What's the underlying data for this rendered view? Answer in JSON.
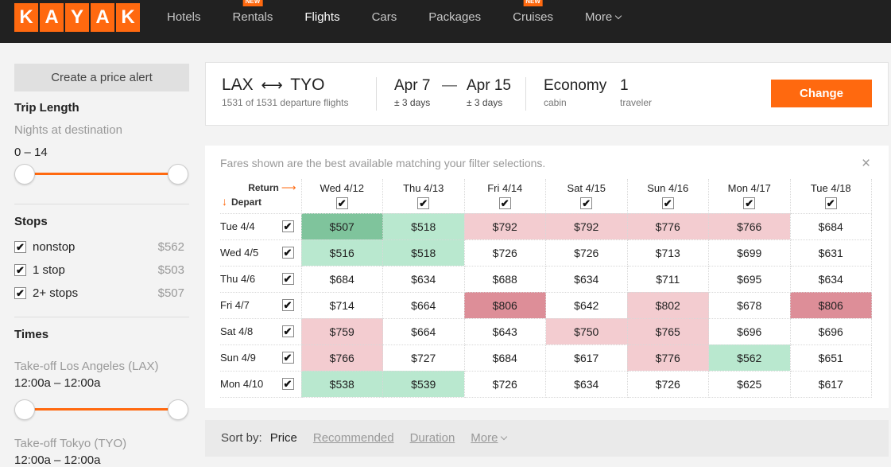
{
  "header": {
    "logo_letters": [
      "K",
      "A",
      "Y",
      "A",
      "K"
    ],
    "nav": [
      {
        "label": "Hotels",
        "badge": "",
        "active": false
      },
      {
        "label": "Rentals",
        "badge": "NEW",
        "active": false
      },
      {
        "label": "Flights",
        "badge": "",
        "active": true
      },
      {
        "label": "Cars",
        "badge": "",
        "active": false
      },
      {
        "label": "Packages",
        "badge": "",
        "active": false
      },
      {
        "label": "Cruises",
        "badge": "NEW",
        "active": false
      },
      {
        "label": "More",
        "badge": "",
        "active": false,
        "dropdown": true
      }
    ]
  },
  "sidebar": {
    "alert_button": "Create a price alert",
    "trip_length": {
      "title": "Trip Length",
      "label": "Nights at destination",
      "range": "0 – 14",
      "min_frac": 0,
      "max_frac": 1
    },
    "stops": {
      "title": "Stops",
      "items": [
        {
          "label": "nonstop",
          "price": "$562",
          "checked": true
        },
        {
          "label": "1 stop",
          "price": "$503",
          "checked": true
        },
        {
          "label": "2+ stops",
          "price": "$507",
          "checked": true
        }
      ]
    },
    "times": {
      "title": "Times",
      "takeoff_lax": {
        "label": "Take-off Los Angeles (LAX)",
        "range": "12:00a – 12:00a",
        "min_frac": 0,
        "max_frac": 1
      },
      "takeoff_tyo": {
        "label": "Take-off Tokyo (TYO)",
        "range": "12:00a – 12:00a"
      }
    }
  },
  "summary": {
    "route_from": "LAX",
    "route_arrow": "⟷",
    "route_to": "TYO",
    "flights_count": "1531 of 1531 departure flights",
    "depart_date": "Apr 7",
    "date_dash": "—",
    "return_date": "Apr 15",
    "depart_flex": "± 3 days",
    "return_flex": "± 3 days",
    "cabin_value": "Economy",
    "cabin_label": "cabin",
    "travelers_value": "1",
    "travelers_label": "traveler",
    "change_button": "Change"
  },
  "matrix": {
    "notice": "Fares shown are the best available matching your filter selections.",
    "close": "×",
    "return_label": "Return",
    "depart_label": "Depart",
    "columns": [
      "Wed 4/12",
      "Thu 4/13",
      "Fri 4/14",
      "Sat 4/15",
      "Sun 4/16",
      "Mon 4/17",
      "Tue 4/18"
    ],
    "rows": [
      {
        "label": "Tue 4/4",
        "cells": [
          {
            "p": "$507",
            "t": "g2"
          },
          {
            "p": "$518",
            "t": "g1"
          },
          {
            "p": "$792",
            "t": "r1"
          },
          {
            "p": "$792",
            "t": "r1"
          },
          {
            "p": "$776",
            "t": "r1"
          },
          {
            "p": "$766",
            "t": "r1"
          },
          {
            "p": "$684",
            "t": ""
          }
        ]
      },
      {
        "label": "Wed 4/5",
        "cells": [
          {
            "p": "$516",
            "t": "g1"
          },
          {
            "p": "$518",
            "t": "g1"
          },
          {
            "p": "$726",
            "t": ""
          },
          {
            "p": "$726",
            "t": ""
          },
          {
            "p": "$713",
            "t": ""
          },
          {
            "p": "$699",
            "t": ""
          },
          {
            "p": "$631",
            "t": ""
          }
        ]
      },
      {
        "label": "Thu 4/6",
        "cells": [
          {
            "p": "$684",
            "t": ""
          },
          {
            "p": "$634",
            "t": ""
          },
          {
            "p": "$688",
            "t": ""
          },
          {
            "p": "$634",
            "t": ""
          },
          {
            "p": "$711",
            "t": ""
          },
          {
            "p": "$695",
            "t": ""
          },
          {
            "p": "$634",
            "t": ""
          }
        ]
      },
      {
        "label": "Fri 4/7",
        "cells": [
          {
            "p": "$714",
            "t": ""
          },
          {
            "p": "$664",
            "t": ""
          },
          {
            "p": "$806",
            "t": "r2"
          },
          {
            "p": "$642",
            "t": ""
          },
          {
            "p": "$802",
            "t": "r1"
          },
          {
            "p": "$678",
            "t": ""
          },
          {
            "p": "$806",
            "t": "r2"
          }
        ]
      },
      {
        "label": "Sat 4/8",
        "cells": [
          {
            "p": "$759",
            "t": "r1"
          },
          {
            "p": "$664",
            "t": ""
          },
          {
            "p": "$643",
            "t": ""
          },
          {
            "p": "$750",
            "t": "r1"
          },
          {
            "p": "$765",
            "t": "r1"
          },
          {
            "p": "$696",
            "t": ""
          },
          {
            "p": "$696",
            "t": ""
          }
        ]
      },
      {
        "label": "Sun 4/9",
        "cells": [
          {
            "p": "$766",
            "t": "r1"
          },
          {
            "p": "$727",
            "t": ""
          },
          {
            "p": "$684",
            "t": ""
          },
          {
            "p": "$617",
            "t": ""
          },
          {
            "p": "$776",
            "t": "r1"
          },
          {
            "p": "$562",
            "t": "g1"
          },
          {
            "p": "$651",
            "t": ""
          }
        ]
      },
      {
        "label": "Mon 4/10",
        "cells": [
          {
            "p": "$538",
            "t": "g1"
          },
          {
            "p": "$539",
            "t": "g1"
          },
          {
            "p": "$726",
            "t": ""
          },
          {
            "p": "$634",
            "t": ""
          },
          {
            "p": "$726",
            "t": ""
          },
          {
            "p": "$625",
            "t": ""
          },
          {
            "p": "$617",
            "t": ""
          }
        ]
      }
    ],
    "tints": {
      "g1": "#b9e8cf",
      "g2": "#7fc49c",
      "r1": "#f3ccd0",
      "r2": "#dd8e98"
    }
  },
  "sortbar": {
    "label": "Sort by:",
    "options": [
      {
        "label": "Price",
        "active": true
      },
      {
        "label": "Recommended",
        "active": false
      },
      {
        "label": "Duration",
        "active": false
      },
      {
        "label": "More",
        "active": false,
        "dropdown": true
      }
    ]
  },
  "colors": {
    "accent": "#ff690f",
    "header_bg": "#212121"
  }
}
